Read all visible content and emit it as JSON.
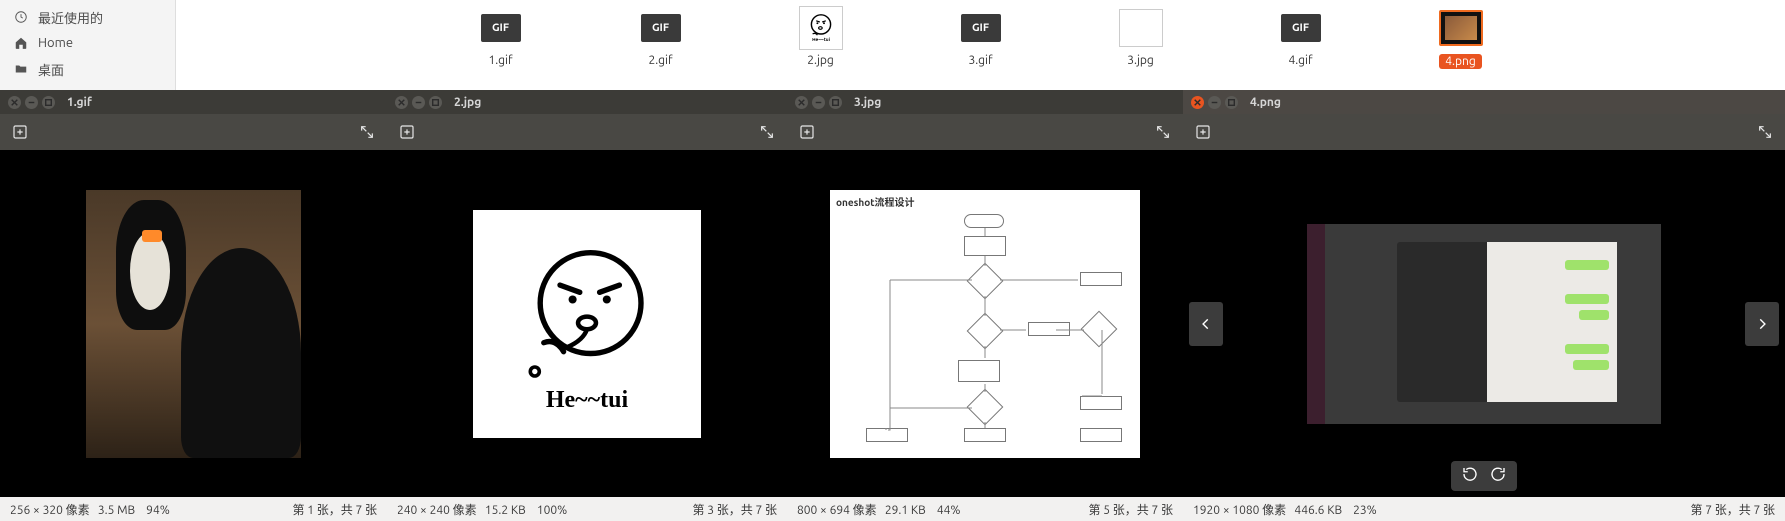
{
  "sidebar": {
    "recent": "最近使用的",
    "home": "Home",
    "desktop": "桌面"
  },
  "files": [
    {
      "name": "1.gif",
      "kind": "gif"
    },
    {
      "name": "2.gif",
      "kind": "gif"
    },
    {
      "name": "2.jpg",
      "kind": "jpg2",
      "caption": "He~~tui"
    },
    {
      "name": "3.gif",
      "kind": "gif"
    },
    {
      "name": "3.jpg",
      "kind": "jpg3"
    },
    {
      "name": "4.gif",
      "kind": "gif"
    },
    {
      "name": "4.png",
      "kind": "png4",
      "selected": true
    }
  ],
  "gif_badge": "GIF",
  "viewers": [
    {
      "title": "1.gif",
      "dimensions": "256 × 320 像素",
      "filesize": "3.5 MB",
      "zoom": "94%",
      "position": "第 1 张，共 7 张",
      "active": false
    },
    {
      "title": "2.jpg",
      "dimensions": "240 × 240 像素",
      "filesize": "15.2 KB",
      "zoom": "100%",
      "position": "第 3 张，共 7 张",
      "caption": "He~~tui",
      "active": false
    },
    {
      "title": "3.jpg",
      "dimensions": "800 × 694 像素",
      "filesize": "29.1 KB",
      "zoom": "44%",
      "position": "第 5 张，共 7 张",
      "heading": "oneshot流程设计",
      "active": false
    },
    {
      "title": "4.png",
      "dimensions": "1920 × 1080 像素",
      "filesize": "446.6 KB",
      "zoom": "23%",
      "position": "第 7 张，共 7 张",
      "active": true
    }
  ]
}
